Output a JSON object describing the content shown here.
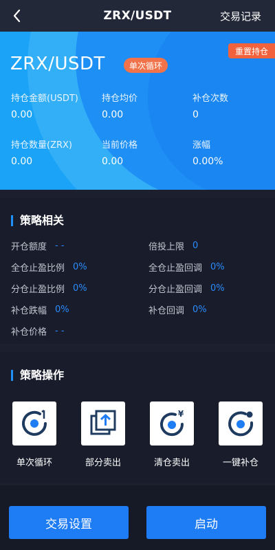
{
  "header": {
    "title": "ZRX/USDT",
    "records_label": "交易记录"
  },
  "hero": {
    "pair": "ZRX/USDT",
    "mode_badge": "单次循环",
    "reset_label": "重置持仓",
    "stats": [
      {
        "label": "持仓金额(USDT)",
        "value": "0.00"
      },
      {
        "label": "持仓均价",
        "value": "0.00"
      },
      {
        "label": "补仓次数",
        "value": "0"
      },
      {
        "label": "持仓数量(ZRX)",
        "value": "0.00"
      },
      {
        "label": "当前价格",
        "value": "0.00"
      },
      {
        "label": "涨幅",
        "value": "0.00%"
      }
    ]
  },
  "strategy": {
    "title": "策略相关",
    "items": [
      {
        "label": "开仓额度",
        "value": "- -"
      },
      {
        "label": "倍投上限",
        "value": "0"
      },
      {
        "label": "全仓止盈比例",
        "value": "0%"
      },
      {
        "label": "全仓止盈回调",
        "value": "0%"
      },
      {
        "label": "分仓止盈比例",
        "value": "0%"
      },
      {
        "label": "分仓止盈回调",
        "value": "0%"
      },
      {
        "label": "补仓跌幅",
        "value": "0%"
      },
      {
        "label": "补仓回调",
        "value": "0%"
      },
      {
        "label": "补仓价格",
        "value": "- -"
      }
    ]
  },
  "operations": {
    "title": "策略操作",
    "items": [
      {
        "label": "单次循环",
        "icon": "single-cycle-icon"
      },
      {
        "label": "部分卖出",
        "icon": "partial-sell-icon"
      },
      {
        "label": "清仓卖出",
        "icon": "clear-sell-icon"
      },
      {
        "label": "一键补仓",
        "icon": "one-click-add-icon"
      }
    ]
  },
  "footer": {
    "settings_label": "交易设置",
    "start_label": "启动"
  },
  "colors": {
    "accent": "#1e7cf5",
    "value_blue": "#2b8cff",
    "badge_orange": "#f2633d",
    "hero_blue": "#1aa3f7"
  }
}
